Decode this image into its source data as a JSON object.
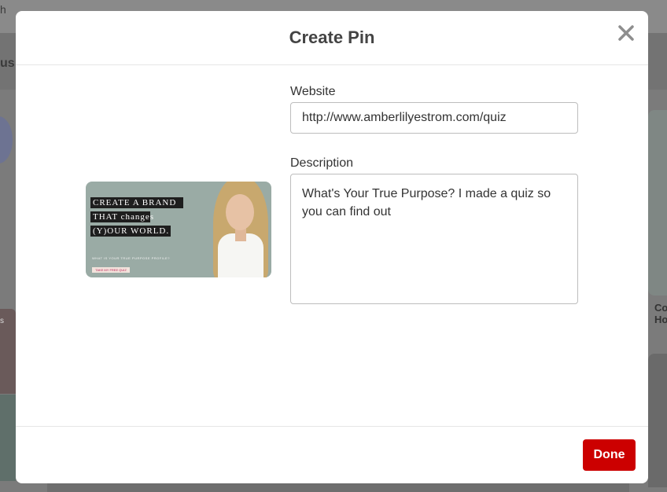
{
  "background": {
    "search_fragment": "h",
    "band_fragment": "us",
    "left_card_fragment": "s",
    "right_text_line1": "Co",
    "right_text_line2": "Ho"
  },
  "modal": {
    "title": "Create Pin",
    "close_icon": "close-icon",
    "pin_image": {
      "alt": "Create a brand that changes your world pin image",
      "line1": "CREATE A BRAND",
      "line2": "THAT changes",
      "line3": "(Y)OUR WORLD.",
      "small_text": "WHAT IS YOUR TRUE PURPOSE PROFILE?",
      "button_text": "TAKE MY FREE QUIZ"
    },
    "website": {
      "label": "Website",
      "value": "http://www.amberlilyestrom.com/quiz"
    },
    "description": {
      "label": "Description",
      "value": "What's Your True Purpose? I made a quiz so you can find out"
    },
    "done_label": "Done"
  },
  "colors": {
    "primary_button": "#cc0000",
    "overlay": "#7a7a7a"
  }
}
